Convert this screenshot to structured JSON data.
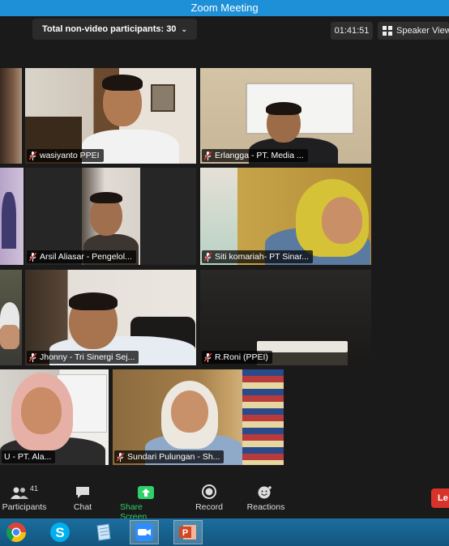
{
  "window": {
    "title": "Zoom Meeting"
  },
  "topbar": {
    "non_video_label": "Total non-video participants: 30",
    "timer": "01:41:51",
    "view_label": "Speaker View"
  },
  "tiles": [
    {
      "name": "wasiyanto PPEI"
    },
    {
      "name": "Erlangga - PT. Media ..."
    },
    {
      "name": "Arsil Aliasar - Pengelol..."
    },
    {
      "name": "Siti komariah- PT Sinar..."
    },
    {
      "name": "Jhonny - Tri Sinergi Sej..."
    },
    {
      "name": "R.Roni (PPEI)"
    },
    {
      "name": "U - PT. Ala..."
    },
    {
      "name": "Sundari Pulungan - Sh..."
    }
  ],
  "toolbar": {
    "participants_label": "Participants",
    "participants_count": "41",
    "chat_label": "Chat",
    "share_label": "Share Screen",
    "record_label": "Record",
    "reactions_label": "Reactions",
    "leave_label": "Le"
  },
  "colors": {
    "title_bar": "#1e90d8",
    "share_green": "#2fd06a",
    "active_speaker_border": "#b8e04a",
    "leave_red": "#d8332b",
    "muted_red": "#e03a3a"
  },
  "taskbar": {
    "icons": [
      "chrome-icon",
      "skype-icon",
      "notepad-icon",
      "zoom-icon",
      "powerpoint-icon"
    ]
  }
}
